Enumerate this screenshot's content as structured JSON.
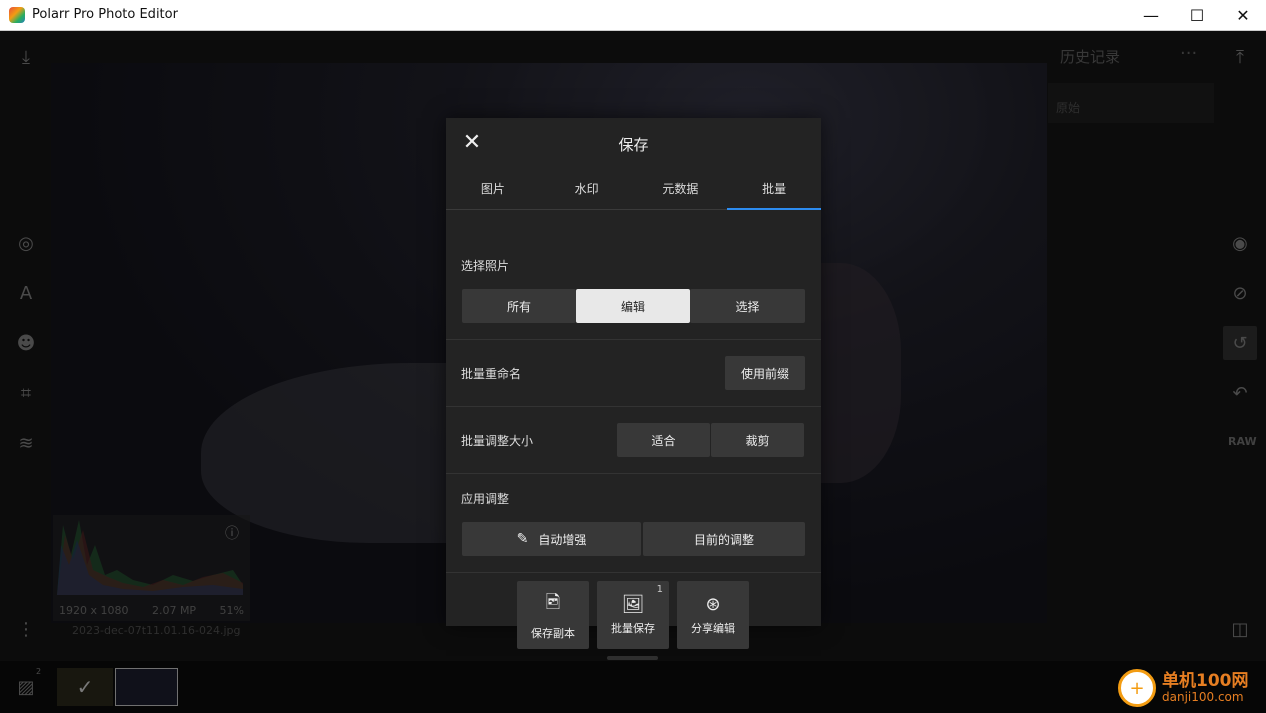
{
  "window": {
    "title": "Polarr Pro Photo Editor",
    "minimize_glyph": "—",
    "maximize_glyph": "☐",
    "close_glyph": "✕"
  },
  "history": {
    "title": "历史记录",
    "menu_glyph": "···",
    "items": [
      "原始"
    ]
  },
  "right_tools": {
    "raw_label": "RAW"
  },
  "histogram": {
    "resolution": "1920 x 1080",
    "megapixels": "2.07 MP",
    "zoom": "51%",
    "info_glyph": "ⓘ"
  },
  "filename": "2023-dec-07t11.01.16-024.jpg",
  "filmstrip": {
    "count_badge": "2",
    "check_glyph": "✓"
  },
  "dialog": {
    "title": "保存",
    "close_glyph": "✕",
    "tabs": [
      "图片",
      "水印",
      "元数据",
      "批量"
    ],
    "active_tab": 3,
    "select_photos": {
      "label": "选择照片",
      "options": [
        "所有",
        "编辑",
        "选择"
      ],
      "selected": 1
    },
    "batch_rename": {
      "label": "批量重命名",
      "button": "使用前缀"
    },
    "batch_resize": {
      "label": "批量调整大小",
      "options": [
        "适合",
        "裁剪"
      ]
    },
    "apply_adjust": {
      "label": "应用调整",
      "auto_enhance": "自动增强",
      "current": "目前的调整"
    },
    "actions": [
      {
        "label": "保存副本",
        "badge": ""
      },
      {
        "label": "批量保存",
        "badge": "1"
      },
      {
        "label": "分享编辑",
        "badge": ""
      }
    ]
  },
  "watermark": {
    "cn": "单机100网",
    "en": "danji100.com"
  }
}
